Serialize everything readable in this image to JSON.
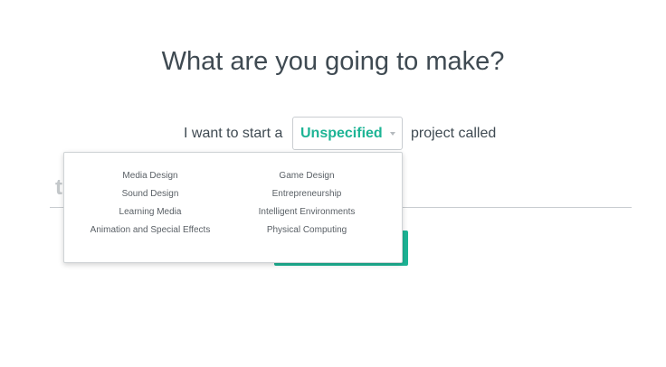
{
  "heading": "What are you going to make?",
  "sentence": {
    "prefix": "I want to start a",
    "suffix": "project called"
  },
  "category_select": {
    "selected": "Unspecified",
    "options_left": [
      "Media Design",
      "Sound Design",
      "Learning Media",
      "Animation and Special Effects"
    ],
    "options_right": [
      "Game Design",
      "Entrepreneurship",
      "Intelligent Environments",
      "Physical Computing"
    ]
  },
  "title_input": {
    "value": "t"
  },
  "colors": {
    "accent": "#1db495",
    "text": "#3f4a52",
    "muted": "#c4c8cb"
  }
}
